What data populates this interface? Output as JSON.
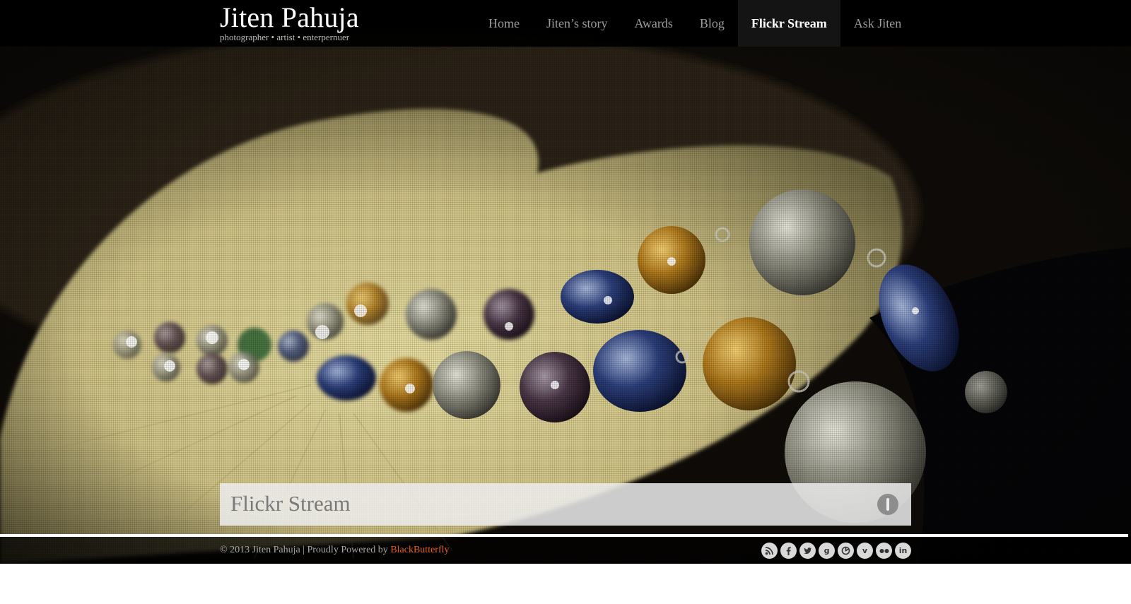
{
  "header": {
    "title": "Jiten Pahuja",
    "tagline": "photographer • artist • enterpernuer",
    "nav": [
      {
        "label": "Home"
      },
      {
        "label": "Jiten’s story"
      },
      {
        "label": "Awards"
      },
      {
        "label": "Blog"
      },
      {
        "label": "Flickr Stream",
        "active": true
      },
      {
        "label": "Ask Jiten"
      }
    ]
  },
  "hero": {
    "image": "bead bracelet on a cream shell-shaped dish",
    "caption": "Flickr Stream",
    "info_icon": "info-icon"
  },
  "footer": {
    "copyright_prefix": "© 2013 Jiten Pahuja | Proudly Powered by ",
    "powered_by": "BlackButterfly",
    "social": [
      {
        "name": "rss-icon"
      },
      {
        "name": "facebook-icon"
      },
      {
        "name": "twitter-icon"
      },
      {
        "name": "google-plus-icon",
        "glyph": "g"
      },
      {
        "name": "picasa-icon"
      },
      {
        "name": "vimeo-icon",
        "glyph": "v"
      },
      {
        "name": "flickr-icon"
      },
      {
        "name": "linkedin-icon",
        "glyph": "in"
      }
    ]
  },
  "colors": {
    "header_bg": "#000000",
    "nav_active_bg": "#141414",
    "link_accent": "#e0621d",
    "caption_text": "#7a7a7a"
  }
}
